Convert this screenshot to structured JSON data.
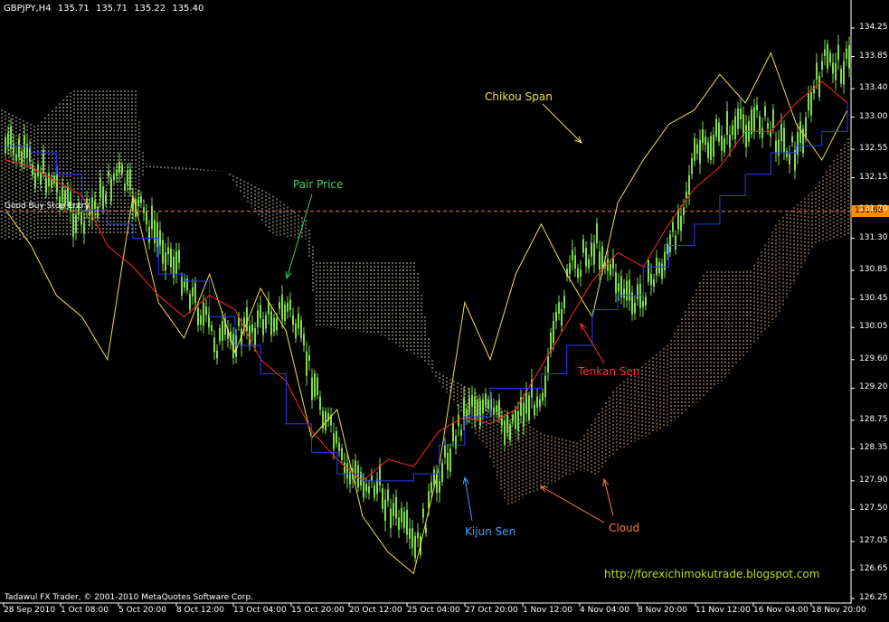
{
  "header": {
    "symbol": "GBPJPY,H4",
    "open": "135.71",
    "high": "135.71",
    "low": "135.22",
    "close": "135.40"
  },
  "horizontal_line": {
    "label": "Good Buy Stop Entry",
    "price": "131.68",
    "color": "#ff8c00"
  },
  "annotations": {
    "chikou": "Chikou Span",
    "pair_price": "Pair Price",
    "tenkan": "Tenkan Sen",
    "kijun": "Kijun Sen",
    "cloud": "Cloud"
  },
  "colors": {
    "background": "#000000",
    "candles": "#7fdc4a",
    "tenkan": "#ff2a1a",
    "kijun": "#2a3aff",
    "chikou": "#f0e04a",
    "cloud_a": "#f5c9a0",
    "cloud_b": "#e8e0d0",
    "chikou_label": "#f0e04a",
    "pair_label": "#3ad16a",
    "tenkan_label": "#ff3030",
    "kijun_label": "#3aa0ff",
    "cloud_label": "#ff7a3a",
    "url": "#b4e01a"
  },
  "url": "http://forexichimokutrade.blogspot.com",
  "copyright": "Tadawul FX Trader, © 2001-2010 MetaQuotes Software Corp.",
  "y_axis": [
    "134.25",
    "133.85",
    "133.40",
    "133.00",
    "132.55",
    "132.15",
    "131.70",
    "131.30",
    "130.85",
    "130.45",
    "130.05",
    "129.60",
    "129.20",
    "128.75",
    "128.35",
    "127.90",
    "127.50",
    "127.05",
    "126.65",
    "126.25"
  ],
  "x_axis": [
    "28 Sep 2010",
    "1 Oct 08:00",
    "5 Oct 20:00",
    "8 Oct 12:00",
    "13 Oct 04:00",
    "15 Oct 20:00",
    "20 Oct 12:00",
    "25 Oct 04:00",
    "27 Oct 20:00",
    "1 Nov 12:00",
    "4 Nov 04:00",
    "8 Nov 20:00",
    "11 Nov 12:00",
    "16 Nov 04:00",
    "18 Nov 20:00"
  ],
  "chart_data": {
    "type": "line",
    "title": "GBPJPY,H4",
    "ylim": [
      126.25,
      134.25
    ],
    "series": [
      {
        "name": "Chikou Span",
        "values": [
          131.7,
          131.2,
          130.5,
          130.2,
          129.6,
          131.9,
          130.4,
          129.9,
          130.8,
          129.7,
          130.6,
          130.0,
          128.5,
          128.9,
          127.4,
          126.9,
          126.6,
          128.1,
          130.4,
          129.6,
          130.8,
          131.5,
          130.8,
          130.2,
          131.8,
          132.4,
          132.9,
          133.1,
          133.6,
          133.2,
          133.9,
          132.9,
          132.4,
          133.1
        ]
      },
      {
        "name": "Tenkan Sen",
        "values": [
          132.4,
          132.3,
          132.1,
          131.9,
          131.2,
          130.9,
          130.5,
          130.2,
          130.5,
          130.3,
          129.6,
          129.3,
          128.6,
          128.2,
          127.9,
          128.2,
          128.1,
          128.6,
          128.8,
          128.7,
          128.9,
          129.5,
          130.1,
          130.7,
          131.1,
          130.9,
          131.5,
          132.0,
          132.3,
          132.8,
          132.8,
          133.2,
          133.5,
          133.2
        ]
      },
      {
        "name": "Kijun Sen",
        "values": [
          132.6,
          132.5,
          132.2,
          131.7,
          131.5,
          131.3,
          130.8,
          130.7,
          130.2,
          129.8,
          129.4,
          128.7,
          128.3,
          128.0,
          127.9,
          127.9,
          128.0,
          128.4,
          128.8,
          129.2,
          129.2,
          129.4,
          129.8,
          130.3,
          130.5,
          130.9,
          131.2,
          131.5,
          131.9,
          132.2,
          132.5,
          132.6,
          132.8,
          133.2
        ]
      }
    ]
  }
}
